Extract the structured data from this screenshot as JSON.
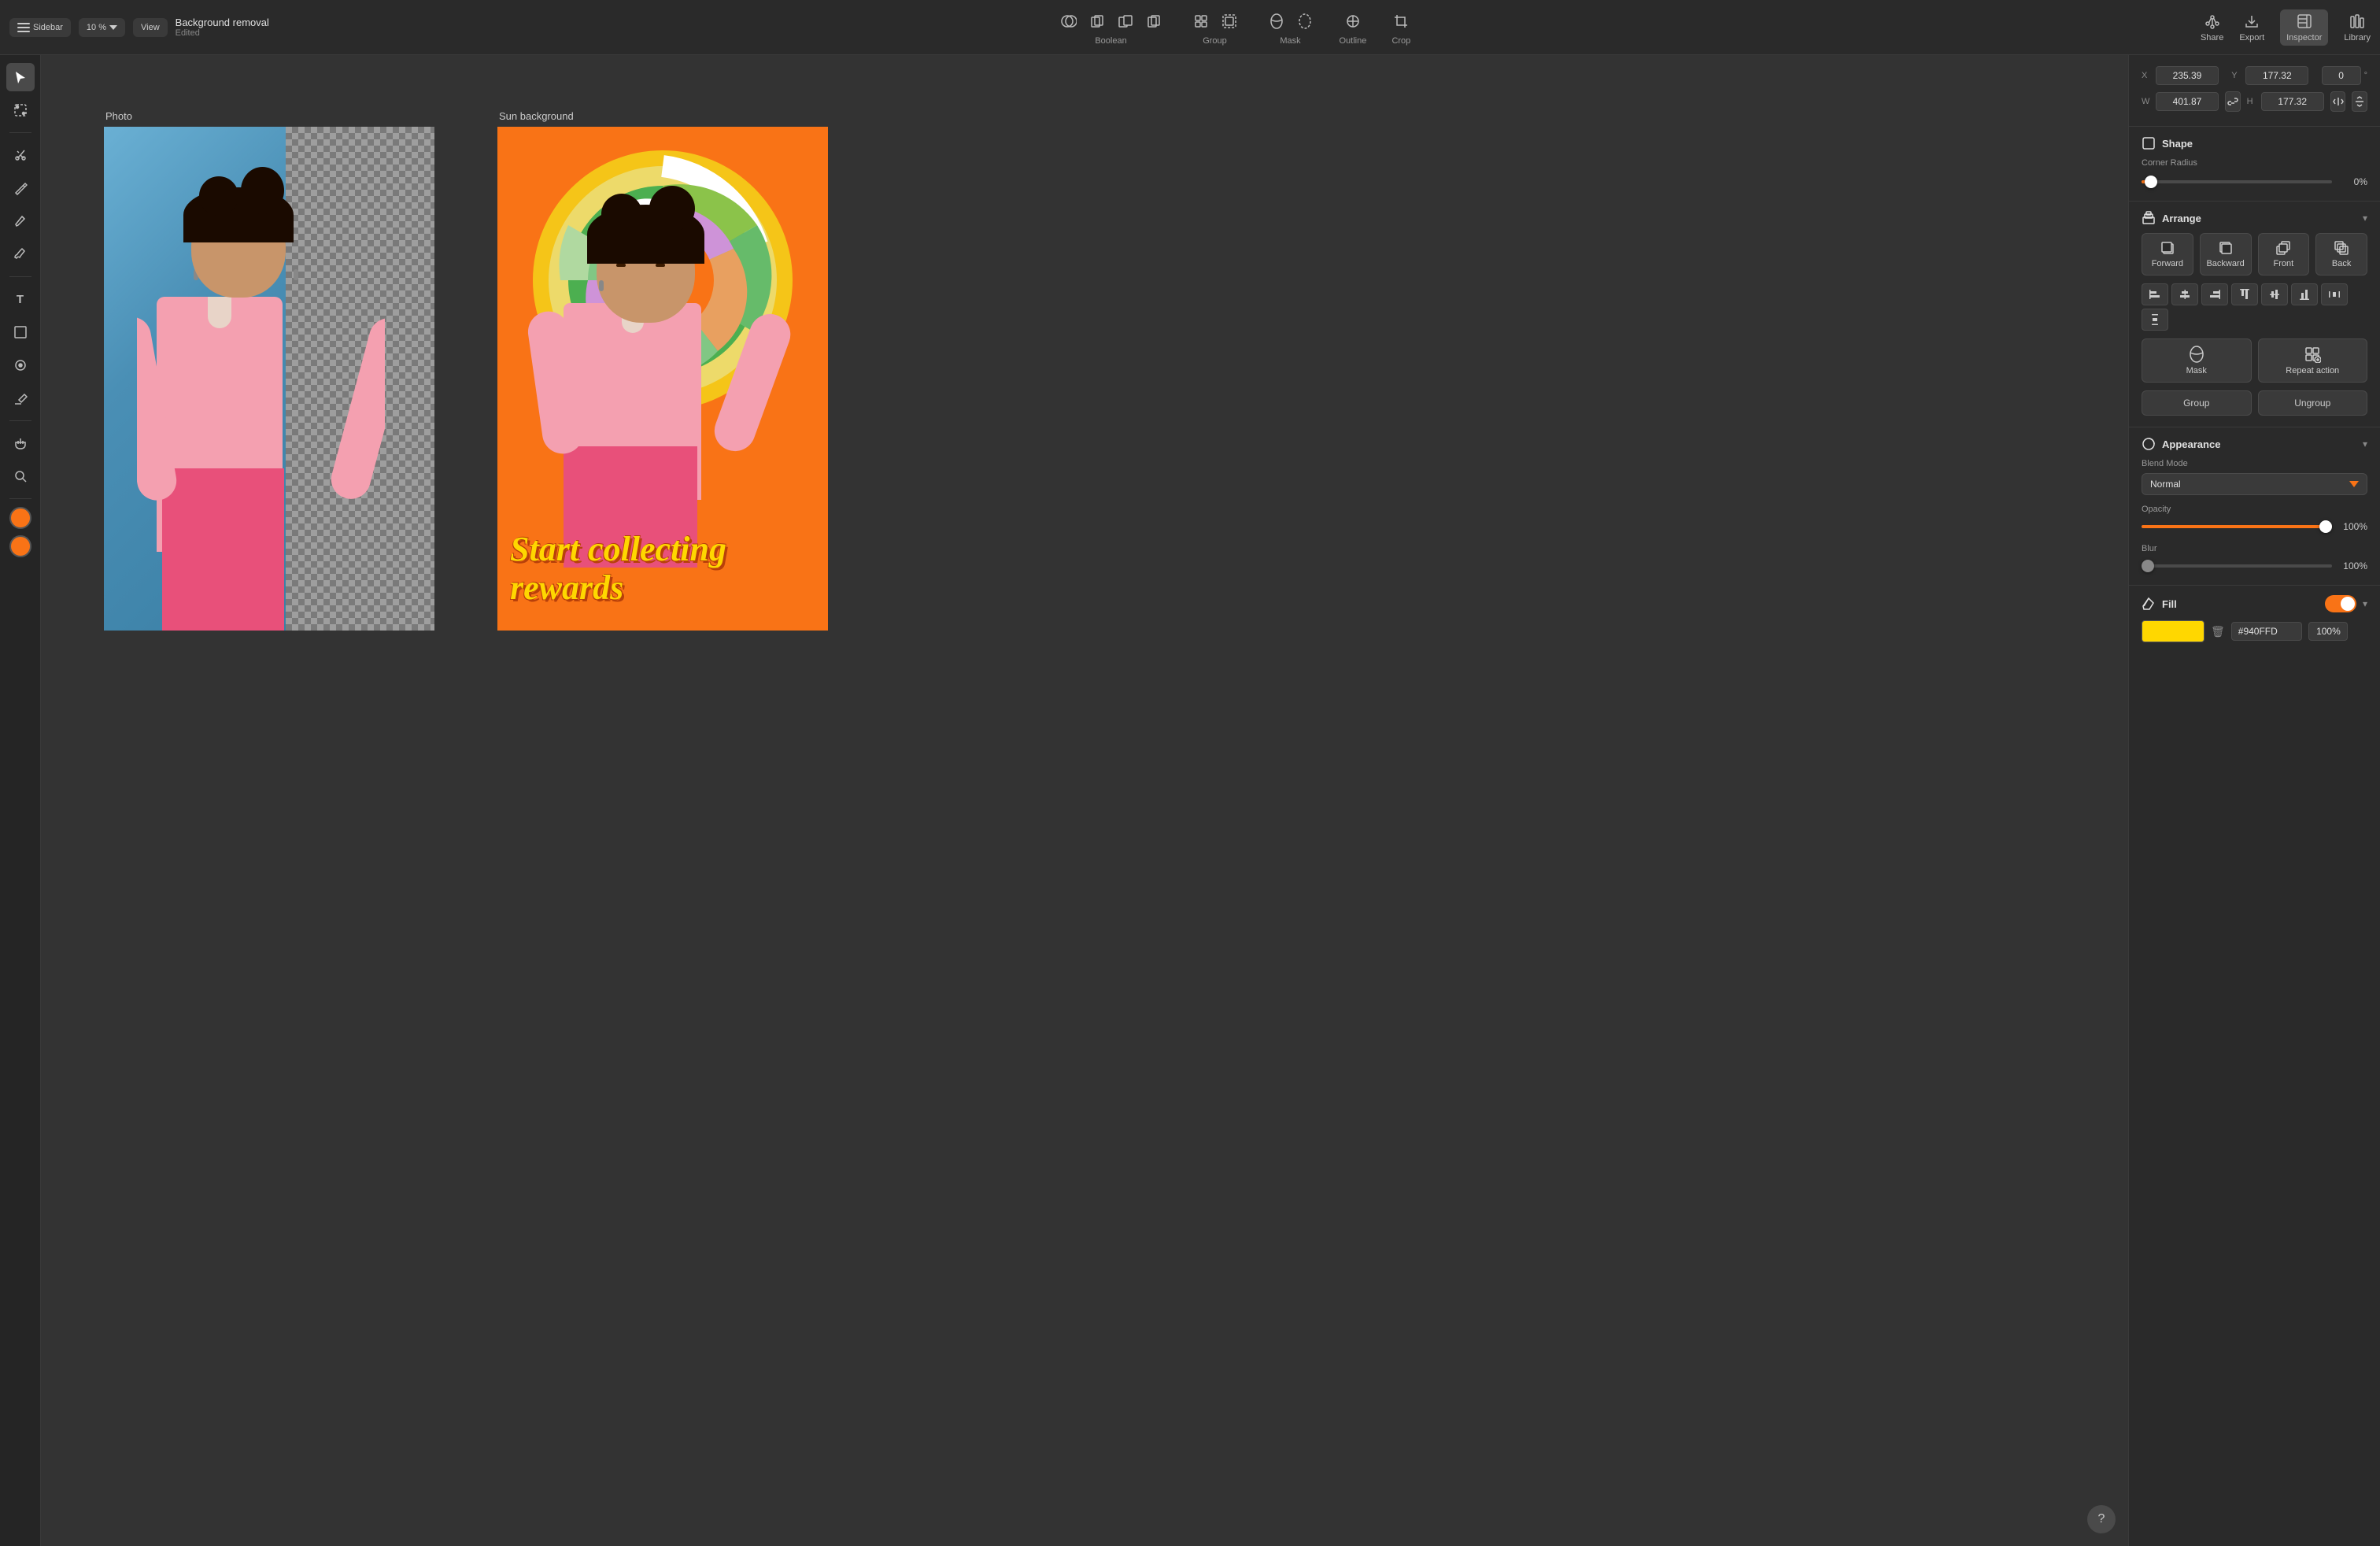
{
  "toolbar": {
    "sidebar_label": "Sidebar",
    "view_label": "View",
    "zoom_value": "10 %",
    "doc_title": "Background removal",
    "doc_status": "Edited",
    "boolean_label": "Boolean",
    "group_label": "Group",
    "mask_label": "Mask",
    "outline_label": "Outline",
    "crop_label": "Crop",
    "share_label": "Share",
    "export_label": "Export",
    "inspector_label": "Inspector",
    "library_label": "Library"
  },
  "canvas": {
    "artboard1": {
      "label": "Photo"
    },
    "artboard2": {
      "label": "Sun background"
    },
    "rewards_text": "Start collecting\nrewards",
    "help_btn": "?"
  },
  "inspector": {
    "x_value": "235.39",
    "x_label": "X",
    "y_value": "177.32",
    "y_label": "Y",
    "rotation_value": "0",
    "w_value": "401.87",
    "w_label": "W",
    "h_value": "177.32",
    "h_label": "H",
    "shape_title": "Shape",
    "corner_radius_label": "Corner Radius",
    "corner_radius_value": "0%",
    "arrange_title": "Arrange",
    "forward_label": "Forward",
    "backward_label": "Backward",
    "front_label": "Front",
    "back_label": "Back",
    "mask_label": "Mask",
    "repeat_action_label": "Repeat action",
    "group_label": "Group",
    "ungroup_label": "Ungroup",
    "appearance_title": "Appearance",
    "blend_mode_label": "Blend Mode",
    "blend_mode_value": "Normal",
    "opacity_label": "Opacity",
    "opacity_value": "100%",
    "blur_label": "Blur",
    "blur_value": "100%",
    "fill_title": "Fill",
    "fill_hex": "#940FFD",
    "fill_opacity": "100%",
    "fill_color": "#FFD700"
  },
  "tools": {
    "select": "▲",
    "lasso": "⬚",
    "cut": "✂",
    "pen": "✒",
    "pencil": "✏",
    "brush": "/",
    "text": "T",
    "shape": "⬜",
    "lasso2": "⊙",
    "eraser": "◻",
    "fill_tool": "✋",
    "zoom": "🔍"
  },
  "colors": {
    "orange_swatch": "#F97316",
    "accent": "#F97316",
    "inspector_bg": "#2a2a2a",
    "canvas_bg": "#333333",
    "artboard_orange": "#F07820"
  }
}
